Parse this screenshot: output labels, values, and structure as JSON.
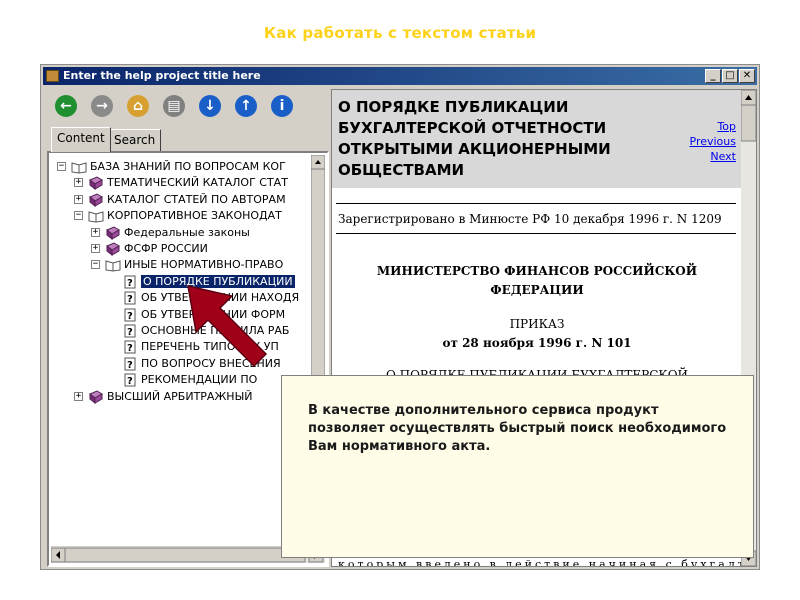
{
  "slide": {
    "title": "Как работать с текстом статьи"
  },
  "window": {
    "title": "Enter the help project title here",
    "controls": {
      "minimize": "_",
      "maximize": "□",
      "close": "✕"
    }
  },
  "toolbar": {
    "buttons": [
      {
        "name": "back",
        "icon": "back-arrow-icon",
        "glyph": "←",
        "color": "#1f8f2f"
      },
      {
        "name": "forward",
        "icon": "forward-arrow-icon",
        "glyph": "→",
        "color": "#8a8a8a"
      },
      {
        "name": "home",
        "icon": "home-icon",
        "glyph": "⌂",
        "color": "#d8a030"
      },
      {
        "name": "print",
        "icon": "print-icon",
        "glyph": "▤",
        "color": "#808080"
      },
      {
        "name": "next-topic",
        "icon": "down-arrow-icon",
        "glyph": "↓",
        "color": "#1a5fc8"
      },
      {
        "name": "prev-topic",
        "icon": "up-arrow-icon",
        "glyph": "↑",
        "color": "#1a5fc8"
      },
      {
        "name": "info",
        "icon": "info-icon",
        "glyph": "i",
        "color": "#1a5fc8"
      }
    ]
  },
  "tabs": {
    "content": "Content",
    "search": "Search"
  },
  "tree": {
    "items": [
      {
        "label": "БАЗА ЗНАНИЙ ПО ВОПРОСАМ КОГ",
        "level": 0,
        "expander": "−",
        "icon": "open-book-icon"
      },
      {
        "label": "ТЕМАТИЧЕСКИЙ КАТАЛОГ СТАТ",
        "level": 1,
        "expander": "+",
        "icon": "book-icon"
      },
      {
        "label": "КАТАЛОГ СТАТЕЙ ПО АВТОРАМ",
        "level": 1,
        "expander": "+",
        "icon": "book-icon"
      },
      {
        "label": "КОРПОРАТИВНОЕ ЗАКОНОДАТ",
        "level": 1,
        "expander": "−",
        "icon": "open-book-icon"
      },
      {
        "label": "Федеральные законы",
        "level": 2,
        "expander": "+",
        "icon": "book-icon"
      },
      {
        "label": "ФСФР РОССИИ",
        "level": 2,
        "expander": "+",
        "icon": "book-icon"
      },
      {
        "label": "ИНЫЕ НОРМАТИВНО-ПРАВО",
        "level": 2,
        "expander": "−",
        "icon": "open-book-icon"
      },
      {
        "label": "О ПОРЯДКЕ ПУБЛИКАЦИИ",
        "level": 3,
        "expander": "",
        "icon": "help-page-icon",
        "selected": true
      },
      {
        "label": "ОБ УТВЕРЖДЕНИИ НАХОДЯ",
        "level": 3,
        "expander": "",
        "icon": "help-page-icon"
      },
      {
        "label": "ОБ УТВЕРЖДЕНИИ ФОРМ",
        "level": 3,
        "expander": "",
        "icon": "help-page-icon"
      },
      {
        "label": "ОСНОВНЫЕ ПРАВИЛА РАБ",
        "level": 3,
        "expander": "",
        "icon": "help-page-icon"
      },
      {
        "label": "ПЕРЕЧЕНЬ ТИПОВЫХ УП",
        "level": 3,
        "expander": "",
        "icon": "help-page-icon"
      },
      {
        "label": "ПО ВОПРОСУ ВНЕСЕНИЯ",
        "level": 3,
        "expander": "",
        "icon": "help-page-icon"
      },
      {
        "label": "РЕКОМЕНДАЦИИ ПО",
        "level": 3,
        "expander": "",
        "icon": "help-page-icon"
      },
      {
        "label": "ВЫСШИЙ АРБИТРАЖНЫЙ",
        "level": 1,
        "expander": "+",
        "icon": "book-icon"
      }
    ]
  },
  "document": {
    "heading": "О ПОРЯДКЕ ПУБЛИКАЦИИ БУХГАЛТЕРСКОЙ ОТЧЕТНОСТИ ОТКРЫТЫМИ АКЦИОНЕРНЫМИ ОБЩЕСТВАМИ",
    "nav": {
      "top": "Top",
      "previous": "Previous",
      "next": "Next"
    },
    "registered": "Зарегистрировано в Минюсте РФ 10 декабря 1996 г. N 1209",
    "ministry_line1": "МИНИСТЕРСТВО ФИНАНСОВ РОССИЙСКОЙ",
    "ministry_line2": "ФЕДЕРАЦИИ",
    "order": "ПРИКАЗ",
    "order_date": "от 28 ноября 1996 г. N 101",
    "subtitle_partial": "О ПОРЯДКЕ ПУБЛИКАЦИИ БУХГАЛТЕРСКОЙ",
    "bottom_partial": "которым введено в действие начиная с бухгалтерской"
  },
  "note": {
    "text": "В качестве дополнительного сервиса продукт позволяет осуществлять быстрый поиск необходимого Вам нормативного акта."
  },
  "colors": {
    "title": "#ffd21a",
    "titlebar": "#0a246a",
    "selection": "#0a246a",
    "arrow": "#a00018",
    "link": "#0000ee"
  }
}
